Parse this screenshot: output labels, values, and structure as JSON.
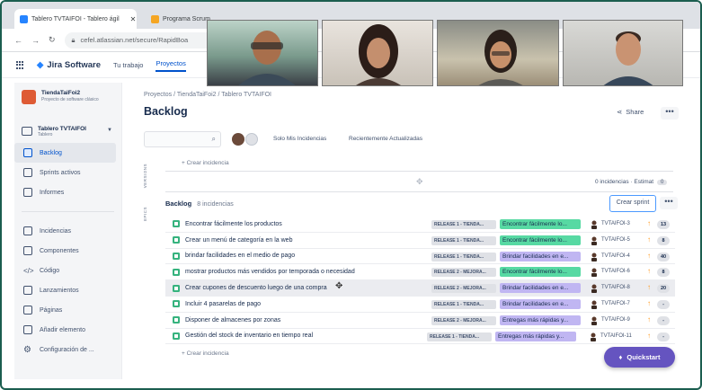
{
  "browser": {
    "tabs": [
      {
        "title": "Tablero TVTAIFOI - Tablero ágil"
      },
      {
        "title": "Programa Scrum"
      }
    ],
    "tab_close": "✕",
    "url": "cefel.atlassian.net/secure/RapidBoa"
  },
  "nav": {
    "brand": "Jira Software",
    "items": [
      "Tu trabajo",
      "Proyectos"
    ]
  },
  "sidebar": {
    "project_name": "TiendaTaiFoi2",
    "project_type": "Proyecto de software clásico",
    "board_name": "Tablero TVTAIFOI",
    "board_type": "Tablero",
    "primary": [
      "Backlog",
      "Sprints activos",
      "Informes"
    ],
    "secondary": [
      "Incidencias",
      "Componentes",
      "Código",
      "Lanzamientos",
      "Páginas",
      "Añadir elemento",
      "Configuración de ..."
    ]
  },
  "page": {
    "breadcrumbs": "Proyectos  /  TiendaTaiFoi2  /  Tablero TVTAIFOI",
    "title": "Backlog",
    "share_label": "Share",
    "more_label": "•••",
    "filters": [
      "Solo Mis Incidencias",
      "Recientemente Actualizadas"
    ],
    "create_issue": "+ Crear incidencia",
    "versions_label": "VERSIONS",
    "epics_label": "EPICS",
    "sprint_counts": "0 incidencias · Estimat",
    "sprint_pill": "0",
    "backlog_label": "Backlog",
    "backlog_count": "8 incidencias",
    "create_sprint": "Crear sprint",
    "quickstart": "Quickstart"
  },
  "issues": [
    {
      "summary": "Encontrar fácilmente los productos",
      "release": "RELEASE 1 - TIENDA...",
      "epic": "Encontrar fácilmente lo...",
      "epic_color": "#57d9a3",
      "key": "TVTAIFOI-3",
      "estimate": "13"
    },
    {
      "summary": "Crear un menú de categoría en la web",
      "release": "RELEASE 1 - TIENDA...",
      "epic": "Encontrar fácilmente lo...",
      "epic_color": "#57d9a3",
      "key": "TVTAIFOI-5",
      "estimate": "8"
    },
    {
      "summary": "brindar facilidades en el medio de pago",
      "release": "RELEASE 1 - TIENDA...",
      "epic": "Brindar facilidades en e...",
      "epic_color": "#c0b6f2",
      "key": "TVTAIFOI-4",
      "estimate": "40"
    },
    {
      "summary": "mostrar productos más vendidos por temporada o necesidad",
      "release": "RELEASE 2 - MEJORA...",
      "epic": "Encontrar fácilmente lo...",
      "epic_color": "#57d9a3",
      "key": "TVTAIFOI-6",
      "estimate": "8"
    },
    {
      "summary": "Crear cupones de descuento luego de una compra",
      "release": "RELEASE 2 - MEJORA...",
      "epic": "Brindar facilidades en e...",
      "epic_color": "#c0b6f2",
      "key": "TVTAIFOI-8",
      "estimate": "20"
    },
    {
      "summary": "Incluir 4 pasarelas de pago",
      "release": "RELEASE 1 - TIENDA...",
      "epic": "Brindar facilidades en e...",
      "epic_color": "#c0b6f2",
      "key": "TVTAIFOI-7",
      "estimate": "-"
    },
    {
      "summary": "Disponer de almacenes por zonas",
      "release": "RELEASE 2 - MEJORA...",
      "epic": "Entregas más rápidas y...",
      "epic_color": "#c0b6f2",
      "key": "TVTAIFOI-9",
      "estimate": "-"
    },
    {
      "summary": "Gestión del stock de inventario en tiempo real",
      "release": "RELEASE 1 - TIENDA...",
      "epic": "Entregas más rápidas y...",
      "epic_color": "#c0b6f2",
      "key": "TVTAIFOI-11",
      "estimate": "-"
    }
  ],
  "colors": {
    "accent": "#0052cc",
    "quickstart": "#6554c0",
    "story": "#36b37e",
    "priority": "#ff991f",
    "frame": "#1b5e4f"
  }
}
